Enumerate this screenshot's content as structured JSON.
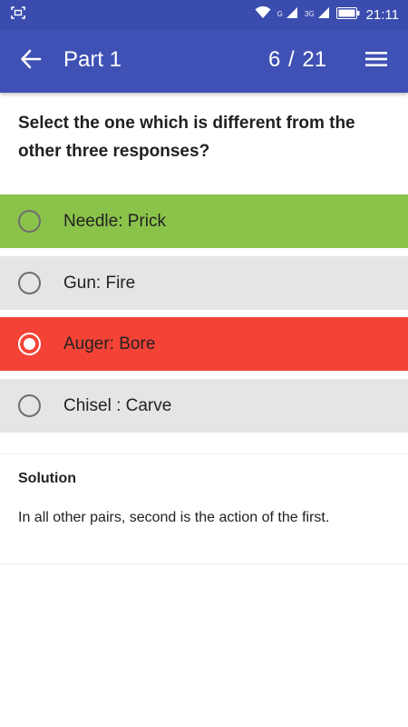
{
  "status_bar": {
    "time": "21:11",
    "network_label_1": "G",
    "network_label_2": "3G",
    "icons": [
      "screenshot-icon",
      "wifi-icon",
      "signal-icon",
      "battery-icon"
    ]
  },
  "app_bar": {
    "title": "Part 1",
    "progress": "6  / 21",
    "back_icon": "arrow-left-icon",
    "menu_icon": "menu-icon",
    "color": "#3f51b5"
  },
  "question": {
    "text": "Select the one which is different from the other three responses?"
  },
  "options": [
    {
      "label": "Needle: Prick",
      "state": "correct",
      "selected": false,
      "color": "#8bc34a"
    },
    {
      "label": "Gun: Fire",
      "state": "neutral",
      "selected": false,
      "color": "#e5e5e5"
    },
    {
      "label": "Auger: Bore",
      "state": "wrong",
      "selected": true,
      "color": "#f44336"
    },
    {
      "label": "Chisel : Carve",
      "state": "neutral",
      "selected": false,
      "color": "#e5e5e5"
    }
  ],
  "solution": {
    "heading": "Solution",
    "text": "In all other pairs, second is the action of the first."
  }
}
